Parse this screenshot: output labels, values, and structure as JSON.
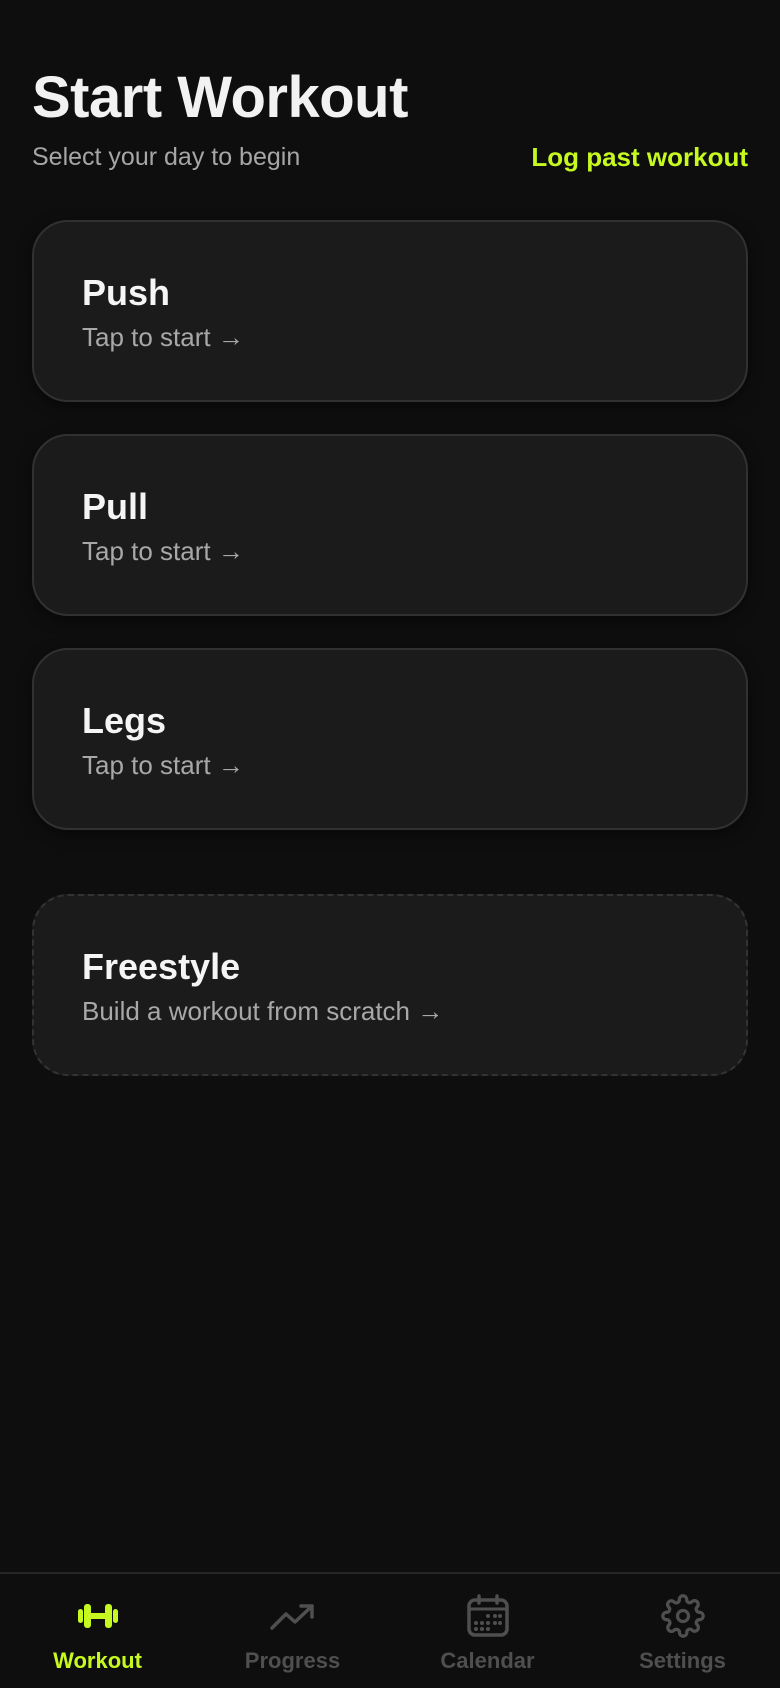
{
  "header": {
    "title": "Start Workout",
    "subtitle": "Select your day to begin",
    "log_link": "Log past workout"
  },
  "cards": [
    {
      "title": "Push",
      "subtitle": "Tap to start →"
    },
    {
      "title": "Pull",
      "subtitle": "Tap to start →"
    },
    {
      "title": "Legs",
      "subtitle": "Tap to start →"
    }
  ],
  "freestyle": {
    "title": "Freestyle",
    "subtitle": "Build a workout from scratch →"
  },
  "tabbar": {
    "items": [
      {
        "label": "Workout",
        "icon": "dumbbell-icon",
        "active": true
      },
      {
        "label": "Progress",
        "icon": "trending-up-icon",
        "active": false
      },
      {
        "label": "Calendar",
        "icon": "calendar-icon",
        "active": false
      },
      {
        "label": "Settings",
        "icon": "gear-icon",
        "active": false
      }
    ]
  },
  "colors": {
    "accent": "#c6f91f",
    "background": "#0e0e0e",
    "card": "#1b1b1b",
    "inactive": "#4f4f4f"
  }
}
